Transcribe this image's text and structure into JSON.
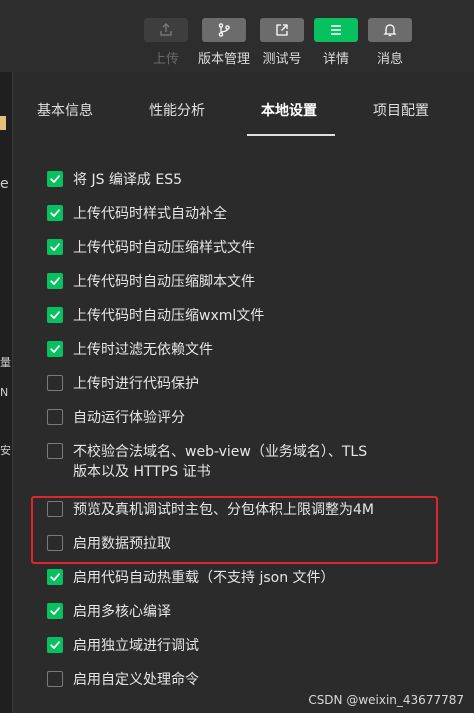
{
  "toolbar": {
    "items": [
      {
        "label": "上传",
        "icon": "upload-icon",
        "state": "disabled"
      },
      {
        "label": "版本管理",
        "icon": "branch-icon",
        "state": "normal"
      },
      {
        "label": "测试号",
        "icon": "external-link-icon",
        "state": "normal"
      },
      {
        "label": "详情",
        "icon": "menu-icon",
        "state": "active"
      },
      {
        "label": "消息",
        "icon": "bell-icon",
        "state": "normal"
      }
    ]
  },
  "left_strip": {
    "fragments": [
      "e",
      "量",
      "N",
      "安"
    ]
  },
  "tabs": [
    {
      "label": "基本信息",
      "active": false
    },
    {
      "label": "性能分析",
      "active": false
    },
    {
      "label": "本地设置",
      "active": true
    },
    {
      "label": "项目配置",
      "active": false
    }
  ],
  "options": [
    {
      "label": "将 JS 编译成 ES5",
      "checked": true
    },
    {
      "label": "上传代码时样式自动补全",
      "checked": true
    },
    {
      "label": "上传代码时自动压缩样式文件",
      "checked": true
    },
    {
      "label": "上传代码时自动压缩脚本文件",
      "checked": true
    },
    {
      "label": "上传代码时自动压缩wxml文件",
      "checked": true
    },
    {
      "label": "上传时过滤无依赖文件",
      "checked": true
    },
    {
      "label": "上传时进行代码保护",
      "checked": false
    },
    {
      "label": "自动运行体验评分",
      "checked": false
    },
    {
      "label": "不校验合法域名、web-view（业务域名）、TLS",
      "label_line2": "版本以及 HTTPS 证书",
      "checked": false,
      "highlighted": true
    },
    {
      "label": "预览及真机调试时主包、分包体积上限调整为4M",
      "checked": false
    },
    {
      "label": "启用数据预拉取",
      "checked": false
    },
    {
      "label": "启用代码自动热重载（不支持 json 文件）",
      "checked": true
    },
    {
      "label": "启用多核心编译",
      "checked": true
    },
    {
      "label": "启用独立域进行调试",
      "checked": true
    },
    {
      "label": "启用自定义处理命令",
      "checked": false
    }
  ],
  "colors": {
    "accent": "#07c160",
    "highlight_border": "#e0262c",
    "background": "#2b2b2b"
  },
  "watermark": "CSDN @weixin_43677787"
}
